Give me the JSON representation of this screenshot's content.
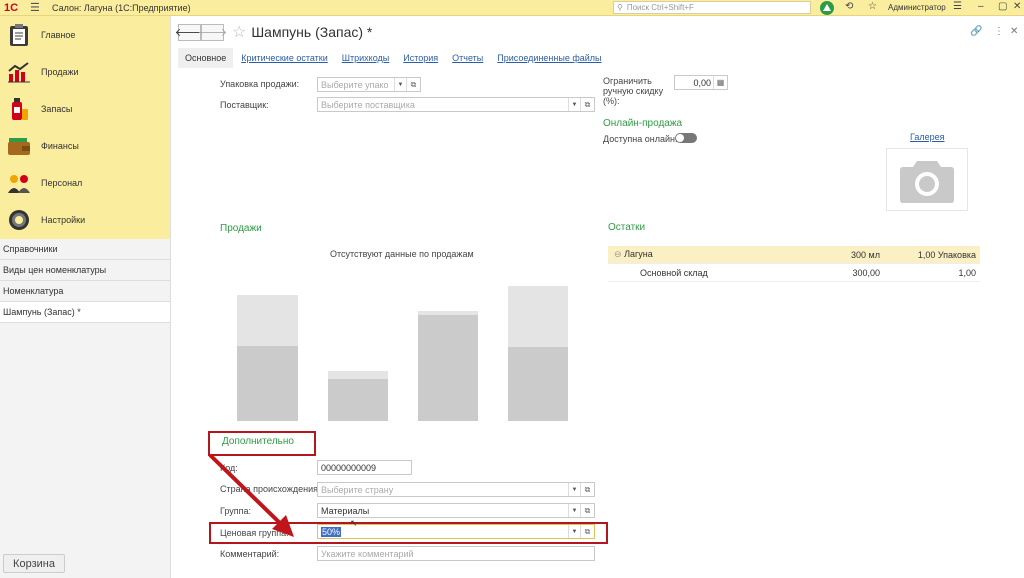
{
  "topbar": {
    "logo": "1С",
    "title": "Салон: Лагуна  (1С:Предприятие)",
    "search_placeholder": "Поиск Ctrl+Shift+F",
    "user": "Администратор"
  },
  "sidebar": {
    "sections": [
      {
        "label": "Главное",
        "icon": "clipboard-icon"
      },
      {
        "label": "Продажи",
        "icon": "chart-up-icon"
      },
      {
        "label": "Запасы",
        "icon": "products-icon"
      },
      {
        "label": "Финансы",
        "icon": "wallet-icon"
      },
      {
        "label": "Персонал",
        "icon": "people-icon"
      },
      {
        "label": "Настройки",
        "icon": "gear-icon"
      }
    ],
    "nav_links": [
      "Справочники",
      "Виды цен номенклатуры",
      "Номенклатура",
      "Шампунь (Запас) *"
    ],
    "basket": "Корзина"
  },
  "header": {
    "title": "Шампунь (Запас) *"
  },
  "tabs": [
    "Основное",
    "Критические остатки",
    "Штрихкоды",
    "История",
    "Отчеты",
    "Присоединенные файлы"
  ],
  "form": {
    "pack_label": "Упаковка продажи:",
    "pack_placeholder": "Выберите упако",
    "supplier_label": "Поставщик:",
    "supplier_placeholder": "Выберите поставщика",
    "limit_label_1": "Ограничить",
    "limit_label_2": "ручную скидку",
    "limit_label_3": "(%):",
    "limit_value": "0,00",
    "online_header": "Онлайн-продажа",
    "online_label": "Доступна онлайн:",
    "gallery_link": "Галерея"
  },
  "sales": {
    "header": "Продажи",
    "empty_text": "Отсутствуют данные по продажам"
  },
  "stock": {
    "header": "Остатки",
    "rows": [
      {
        "name": "Лагуна",
        "qty": "300 мл",
        "pack": "1,00 Упаковка"
      },
      {
        "name": "Основной склад",
        "qty": "300,00",
        "pack": "1,00"
      }
    ]
  },
  "extra": {
    "header": "Дополнительно",
    "code_label": "Код:",
    "code_value": "00000000009",
    "country_label": "Страна происхождения:",
    "country_placeholder": "Выберите страну",
    "group_label": "Группа:",
    "group_value": "Материалы",
    "price_group_label": "Ценовая группа:",
    "price_group_value": "50%",
    "comment_label": "Комментарий:",
    "comment_placeholder": "Укажите комментарий"
  }
}
